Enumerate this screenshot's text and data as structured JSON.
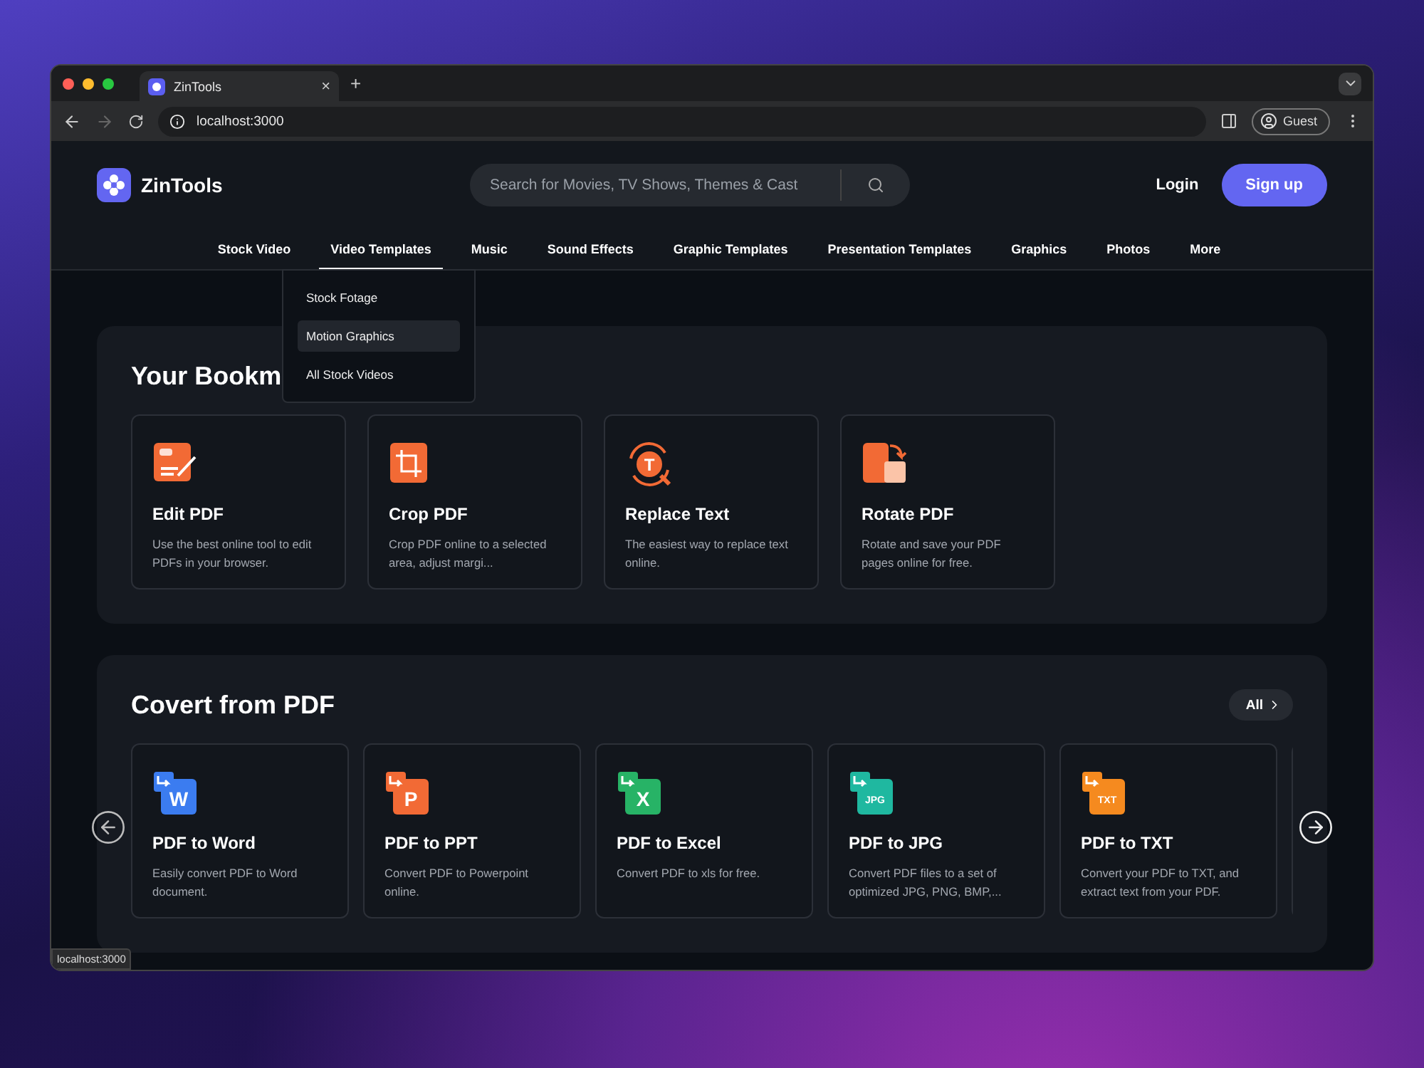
{
  "browser": {
    "tab_title": "ZinTools",
    "tab_close": "×",
    "new_tab": "+",
    "address": "localhost:3000",
    "profile": "Guest",
    "forward_disabled": true
  },
  "header": {
    "brand": "ZinTools",
    "search_placeholder": "Search for Movies, TV Shows, Themes & Cast",
    "login": "Login",
    "signup": "Sign up"
  },
  "nav": [
    {
      "label": "Stock Video",
      "selected": false
    },
    {
      "label": "Video Templates",
      "selected": true
    },
    {
      "label": "Music",
      "selected": false
    },
    {
      "label": "Sound Effects",
      "selected": false
    },
    {
      "label": "Graphic Templates",
      "selected": false
    },
    {
      "label": "Presentation Templates",
      "selected": false
    },
    {
      "label": "Graphics",
      "selected": false
    },
    {
      "label": "Photos",
      "selected": false
    },
    {
      "label": "More",
      "selected": false
    }
  ],
  "dropdown": [
    {
      "label": "Stock Fotage",
      "selected": false
    },
    {
      "label": "Motion Graphics",
      "selected": true
    },
    {
      "label": "All Stock Videos",
      "selected": false
    }
  ],
  "bookmarks": {
    "title": "Your Bookm",
    "items": [
      {
        "kind": "edit",
        "title": "Edit PDF",
        "text": "Use the best online tool to edit PDFs in your browser."
      },
      {
        "kind": "crop",
        "title": "Crop PDF",
        "text": "Crop PDF online to a selected area, adjust margi..."
      },
      {
        "kind": "replace",
        "title": "Replace Text",
        "text": "The easiest way to replace text online.",
        "icon_label": "T"
      },
      {
        "kind": "rotate",
        "title": "Rotate PDF",
        "text": "Rotate and save your PDF pages online for free."
      }
    ]
  },
  "convert": {
    "title": "Covert from PDF",
    "all": "All",
    "items": [
      {
        "title": "PDF to Word",
        "text": "Easily convert PDF to Word document.",
        "icon_label": "W",
        "color": "#3b7cf0"
      },
      {
        "title": "PDF to PPT",
        "text": "Convert PDF to Powerpoint online.",
        "icon_label": "P",
        "color": "#f26a35"
      },
      {
        "title": "PDF to Excel",
        "text": "Convert PDF to xls for free.",
        "icon_label": "X",
        "color": "#27b366"
      },
      {
        "title": "PDF to JPG",
        "text": "Convert PDF files to a set of optimized JPG, PNG, BMP,...",
        "icon_label": "JPG",
        "color": "#1fb8a0"
      },
      {
        "title": "PDF to TXT",
        "text": "Convert your PDF to TXT, and extract text from your PDF.",
        "icon_label": "TXT",
        "color": "#f58a1f"
      }
    ]
  },
  "status": "localhost:3000"
}
